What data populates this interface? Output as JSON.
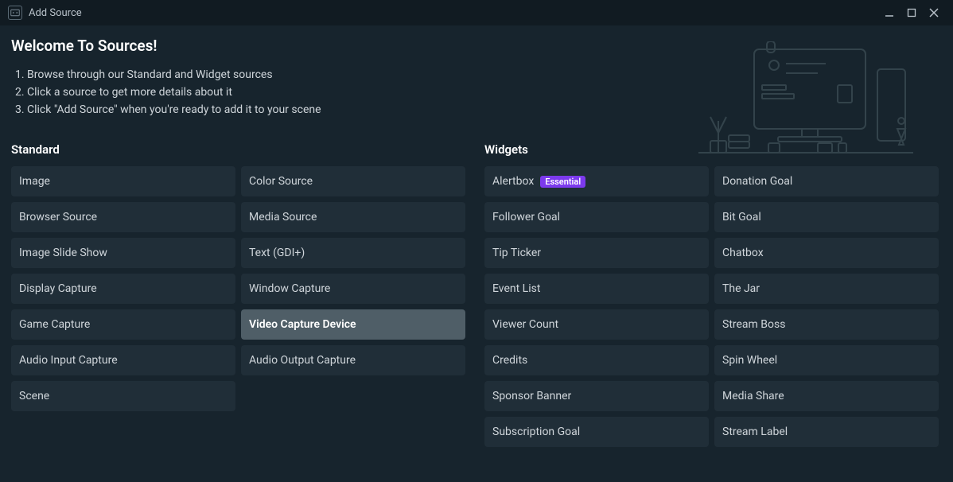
{
  "window": {
    "title": "Add Source"
  },
  "intro": {
    "heading": "Welcome To Sources!",
    "steps": [
      "Browse through our Standard and Widget sources",
      "Click a source to get more details about it",
      "Click \"Add Source\" when you're ready to add it to your scene"
    ]
  },
  "sections": {
    "standard": {
      "title": "Standard",
      "items": [
        {
          "label": "Image"
        },
        {
          "label": "Color Source"
        },
        {
          "label": "Browser Source"
        },
        {
          "label": "Media Source"
        },
        {
          "label": "Image Slide Show"
        },
        {
          "label": "Text (GDI+)"
        },
        {
          "label": "Display Capture"
        },
        {
          "label": "Window Capture"
        },
        {
          "label": "Game Capture"
        },
        {
          "label": "Video Capture Device",
          "selected": true
        },
        {
          "label": "Audio Input Capture"
        },
        {
          "label": "Audio Output Capture"
        },
        {
          "label": "Scene"
        }
      ]
    },
    "widgets": {
      "title": "Widgets",
      "items": [
        {
          "label": "Alertbox",
          "badge": "Essential"
        },
        {
          "label": "Donation Goal"
        },
        {
          "label": "Follower Goal"
        },
        {
          "label": "Bit Goal"
        },
        {
          "label": "Tip Ticker"
        },
        {
          "label": "Chatbox"
        },
        {
          "label": "Event List"
        },
        {
          "label": "The Jar"
        },
        {
          "label": "Viewer Count"
        },
        {
          "label": "Stream Boss"
        },
        {
          "label": "Credits"
        },
        {
          "label": "Spin Wheel"
        },
        {
          "label": "Sponsor Banner"
        },
        {
          "label": "Media Share"
        },
        {
          "label": "Subscription Goal"
        },
        {
          "label": "Stream Label"
        }
      ]
    }
  }
}
